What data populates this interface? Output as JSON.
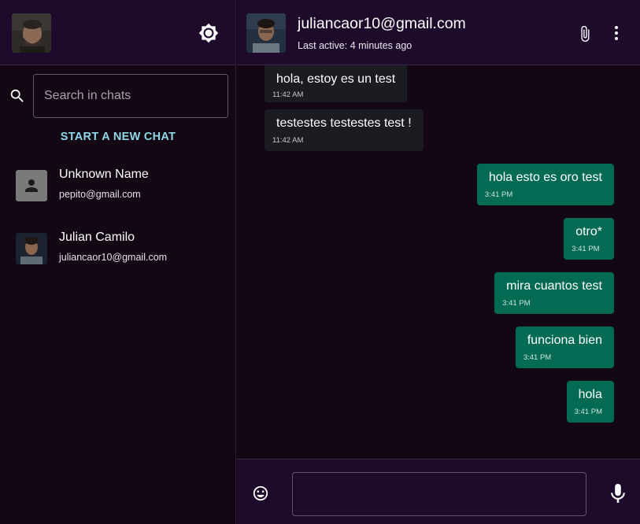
{
  "sidebar": {
    "search": {
      "placeholder": "Search in chats",
      "value": ""
    },
    "new_chat_label": "START A NEW CHAT",
    "chats": [
      {
        "name": "Unknown Name",
        "email": "pepito@gmail.com"
      },
      {
        "name": "Julian Camilo",
        "email": "juliancaor10@gmail.com"
      }
    ]
  },
  "chat": {
    "contact_email": "juliancaor10@gmail.com",
    "last_active": "Last active: 4 minutes ago",
    "messages": [
      {
        "text": "hola, estoy es un test",
        "time": "11:42 AM",
        "direction": "incoming"
      },
      {
        "text": "testestes testestes test !",
        "time": "11:42 AM",
        "direction": "incoming"
      },
      {
        "text": "hola esto es oro test",
        "time": "3:41 PM",
        "direction": "outgoing"
      },
      {
        "text": "otro*",
        "time": "3:41 PM",
        "direction": "outgoing"
      },
      {
        "text": "mira cuantos test",
        "time": "3:41 PM",
        "direction": "outgoing"
      },
      {
        "text": "funciona bien",
        "time": "3:41 PM",
        "direction": "outgoing"
      },
      {
        "text": "hola",
        "time": "3:41 PM",
        "direction": "outgoing"
      }
    ],
    "composer": {
      "value": "",
      "placeholder": ""
    }
  },
  "icons": {
    "theme": "brightness-icon",
    "search": "search-icon",
    "attach": "paperclip-icon",
    "more": "more-vert-icon",
    "emoji": "emoji-icon",
    "mic": "microphone-icon",
    "unknown_user": "person-icon"
  },
  "colors": {
    "header_bg": "#1e0b2c",
    "page_bg": "#120713",
    "incoming_bubble": "#1a1c22",
    "outgoing_bubble": "#036b53",
    "accent": "#8fd8e8"
  }
}
